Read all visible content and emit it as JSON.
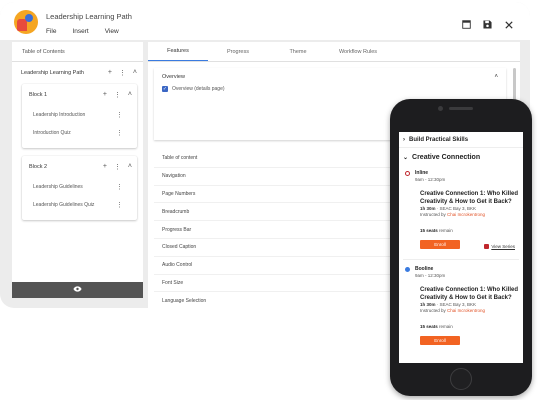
{
  "app": {
    "title": "Leadership Learning Path",
    "menu": [
      "File",
      "Insert",
      "View"
    ]
  },
  "left_panel": {
    "tab": "Table of Contents",
    "root": "Leadership Learning Path",
    "blocks": [
      {
        "title": "Block 1",
        "items": [
          "Leadership Introduction",
          "Introduction Quiz"
        ]
      },
      {
        "title": "Block 2",
        "items": [
          "Leadership Guidelines",
          "Leadership Guidelines Quiz"
        ]
      }
    ]
  },
  "right_panel": {
    "tabs": [
      "Features",
      "Progress",
      "Theme",
      "Workflow Rules"
    ],
    "overview_title": "Overview",
    "overview_checkbox": "Overview (details page)",
    "settings": [
      "Table of content",
      "Navigation",
      "Page Numbers",
      "Breadcrumb",
      "Progress Bar",
      "Closed Caption",
      "Audio Control",
      "Font Size",
      "Language Selection"
    ]
  },
  "phone": {
    "section1": "Build Practical Skills",
    "section2": "Creative Connection",
    "sessions": [
      {
        "mode": "Inline",
        "mode_color": "#c0272d",
        "time": "9am - 12:30pm",
        "title": "Creative Connection 1: Who Killed Creativity & How to Get it Back?",
        "duration": "1h 30m",
        "location": "SEAC Bay 3, BKK",
        "instructor_prefix": "Instructed by",
        "instructor": "Chai Incrokentrong",
        "seats": "15 seats",
        "seats_suffix": "remain",
        "enroll": "Enroll",
        "view_series": "View Series"
      },
      {
        "mode": "Booline",
        "mode_color": "#3a7be0",
        "time": "9am - 12:30pm",
        "title": "Creative Connection 1: Who Killed Creativity & How to Get it Back?",
        "duration": "1h 30m",
        "location": "SEAC Bay 3, BKK",
        "instructor_prefix": "Instructed by",
        "instructor": "Chai Incrokentrong",
        "seats": "15 seats",
        "seats_suffix": "remain",
        "enroll": "Enroll"
      }
    ]
  }
}
